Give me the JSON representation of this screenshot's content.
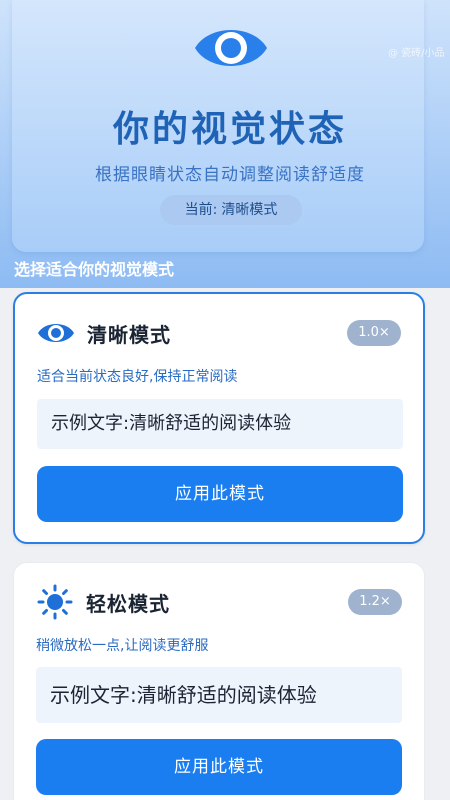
{
  "header": {
    "title": "你的视觉状态",
    "subtitle": "根据眼睛状态自动调整阅读舒适度",
    "current_label": "当前:",
    "current_value": "清晰模式",
    "watermark": "@ 瓷砖/小品"
  },
  "section_title": "选择适合你的视觉模式",
  "modes": [
    {
      "name": "清晰模式",
      "scale": "1.0×",
      "description": "适合当前状态良好,保持正常阅读",
      "sample": "示例文字:清晰舒适的阅读体验",
      "button": "应用此模式",
      "icon": "eye-icon",
      "selected": true
    },
    {
      "name": "轻松模式",
      "scale": "1.2×",
      "description": "稍微放松一点,让阅读更舒服",
      "sample": "示例文字:清晰舒适的阅读体验",
      "button": "应用此模式",
      "icon": "sun-icon",
      "selected": false
    }
  ],
  "colors": {
    "accent": "#1a7ef0",
    "title_blue": "#1f63b6",
    "badge": "#9fb3ce"
  }
}
